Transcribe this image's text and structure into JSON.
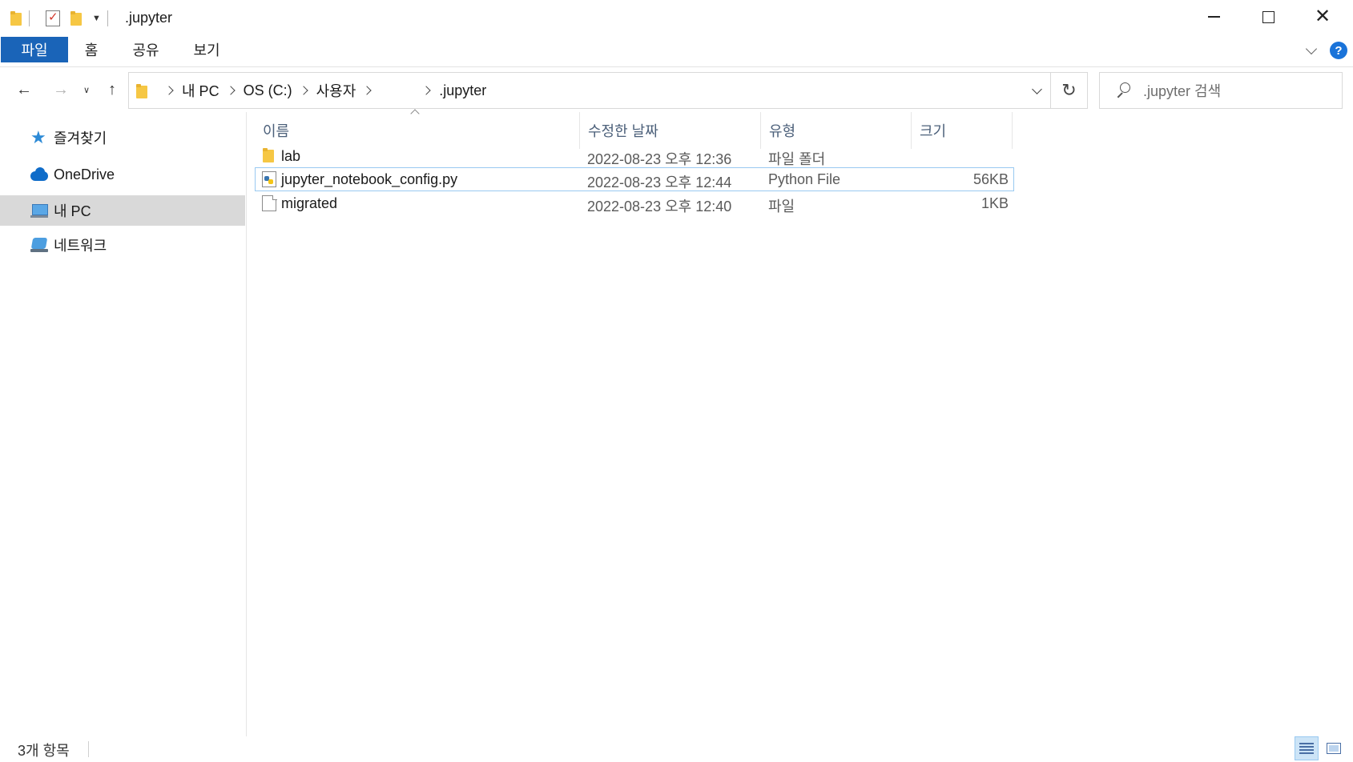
{
  "window": {
    "title": ".jupyter"
  },
  "ribbon": {
    "tabs": [
      {
        "label": "파일"
      },
      {
        "label": "홈"
      },
      {
        "label": "공유"
      },
      {
        "label": "보기"
      }
    ],
    "help_label": "?"
  },
  "address": {
    "crumbs": [
      "내 PC",
      "OS (C:)",
      "사용자",
      ".jupyter"
    ]
  },
  "search": {
    "placeholder": ".jupyter 검색"
  },
  "navpane": {
    "items": [
      {
        "label": "즐겨찾기",
        "icon": "star-icon"
      },
      {
        "label": "OneDrive",
        "icon": "cloud-icon"
      },
      {
        "label": "내 PC",
        "icon": "computer-icon",
        "selected": true
      },
      {
        "label": "네트워크",
        "icon": "network-icon"
      }
    ]
  },
  "columns": {
    "name": "이름",
    "date": "수정한 날짜",
    "type": "유형",
    "size": "크기"
  },
  "files": [
    {
      "name": "lab",
      "date": "2022-08-23 오후 12:36",
      "type": "파일 폴더",
      "size": "",
      "icon": "folder-icon"
    },
    {
      "name": "jupyter_notebook_config.py",
      "date": "2022-08-23 오후 12:44",
      "type": "Python File",
      "size": "56KB",
      "icon": "python-file-icon"
    },
    {
      "name": "migrated",
      "date": "2022-08-23 오후 12:40",
      "type": "파일",
      "size": "1KB",
      "icon": "file-icon"
    }
  ],
  "status": {
    "item_count": "3개 항목"
  },
  "colors": {
    "accent": "#1a64b8",
    "selection": "#d9d9d9",
    "focus_border": "#99c9f1",
    "folder": "#f6c744"
  }
}
